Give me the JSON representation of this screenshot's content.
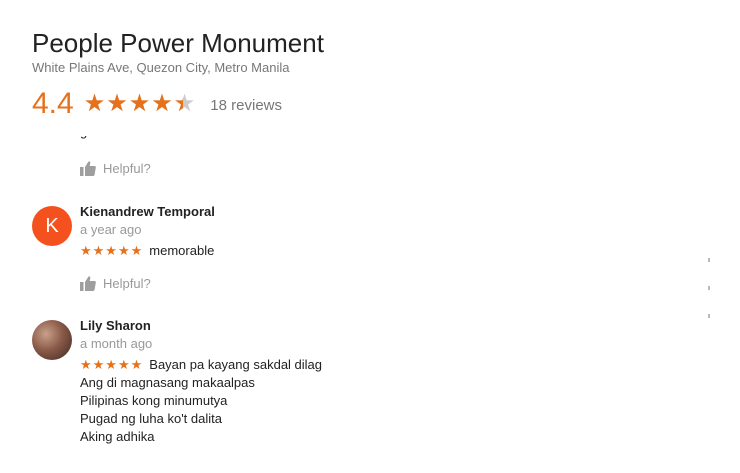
{
  "place": {
    "title": "People Power Monument",
    "address": "White Plains Ave, Quezon City, Metro Manila",
    "rating": "4.4",
    "rating_value": 4.4,
    "review_count": "18 reviews"
  },
  "colors": {
    "accent": "#e7711b",
    "avatar_k": "#f4511e",
    "muted": "#999999"
  },
  "icons": {
    "helpful": "thumbs-up-icon"
  },
  "helpful_label": "Helpful?",
  "reviews": [
    {
      "initial": "K",
      "name": "Kienandrew Temporal",
      "date": "a year ago",
      "stars": "★★★★★",
      "rating": 5,
      "text": "memorable"
    },
    {
      "name": "Lily Sharon",
      "date": "a month ago",
      "stars": "★★★★★",
      "rating": 5,
      "lines": [
        "Bayan pa kayang sakdal dilag",
        "Ang di magnasang makaalpas",
        "Pilipinas kong minumutya",
        "Pugad ng luha ko't dalita",
        "Aking adhika"
      ]
    }
  ]
}
